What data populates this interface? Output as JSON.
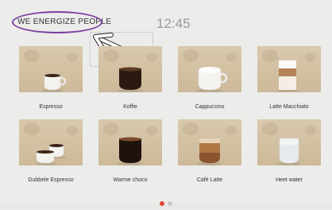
{
  "header": {
    "brand": "WE ENERGIZE PEOPLE",
    "time": "12:45"
  },
  "drinks": [
    {
      "label": "Espresso"
    },
    {
      "label": "Koffie"
    },
    {
      "label": "Cappuccino"
    },
    {
      "label": "Latte Macchiato"
    },
    {
      "label": "Dubbele Espresso"
    },
    {
      "label": "Warme choco"
    },
    {
      "label": "Café Latte"
    },
    {
      "label": "Heet water"
    }
  ],
  "pager": {
    "active": 1,
    "count": 2,
    "active_color": "#e5473d",
    "inactive_color": "#c9c9c9"
  },
  "colors": {
    "highlight_ring": "#7b3fa1",
    "arrow": "#ffffff"
  }
}
